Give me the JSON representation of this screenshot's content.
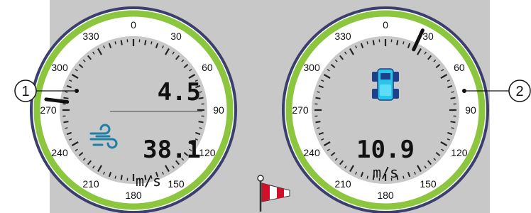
{
  "dial_labels": [
    "0",
    "30",
    "60",
    "90",
    "120",
    "150",
    "180",
    "210",
    "240",
    "270",
    "300",
    "330"
  ],
  "colors": {
    "panel_bg": "#c8c8c8",
    "ring_outer": "#3b3f6e",
    "ring_green": "#8cc63f",
    "dial_face": "#c8c8c8",
    "dial_bezel": "#ffffff",
    "wind_icon": "#1f7fa6",
    "tractor_icon": "#29c5e6",
    "windsock": "#d0102b"
  },
  "left_gauge": {
    "callout": "1",
    "top_value": "4.5",
    "main_value": "38.1",
    "unit": "m/s",
    "needle_direction_deg": 277,
    "icon": "wind-icon"
  },
  "right_gauge": {
    "callout": "2",
    "main_value": "10.9",
    "unit": "m/s",
    "needle_direction_deg": 25,
    "icon": "tractor-icon"
  },
  "footer_icon": "windsock-icon"
}
